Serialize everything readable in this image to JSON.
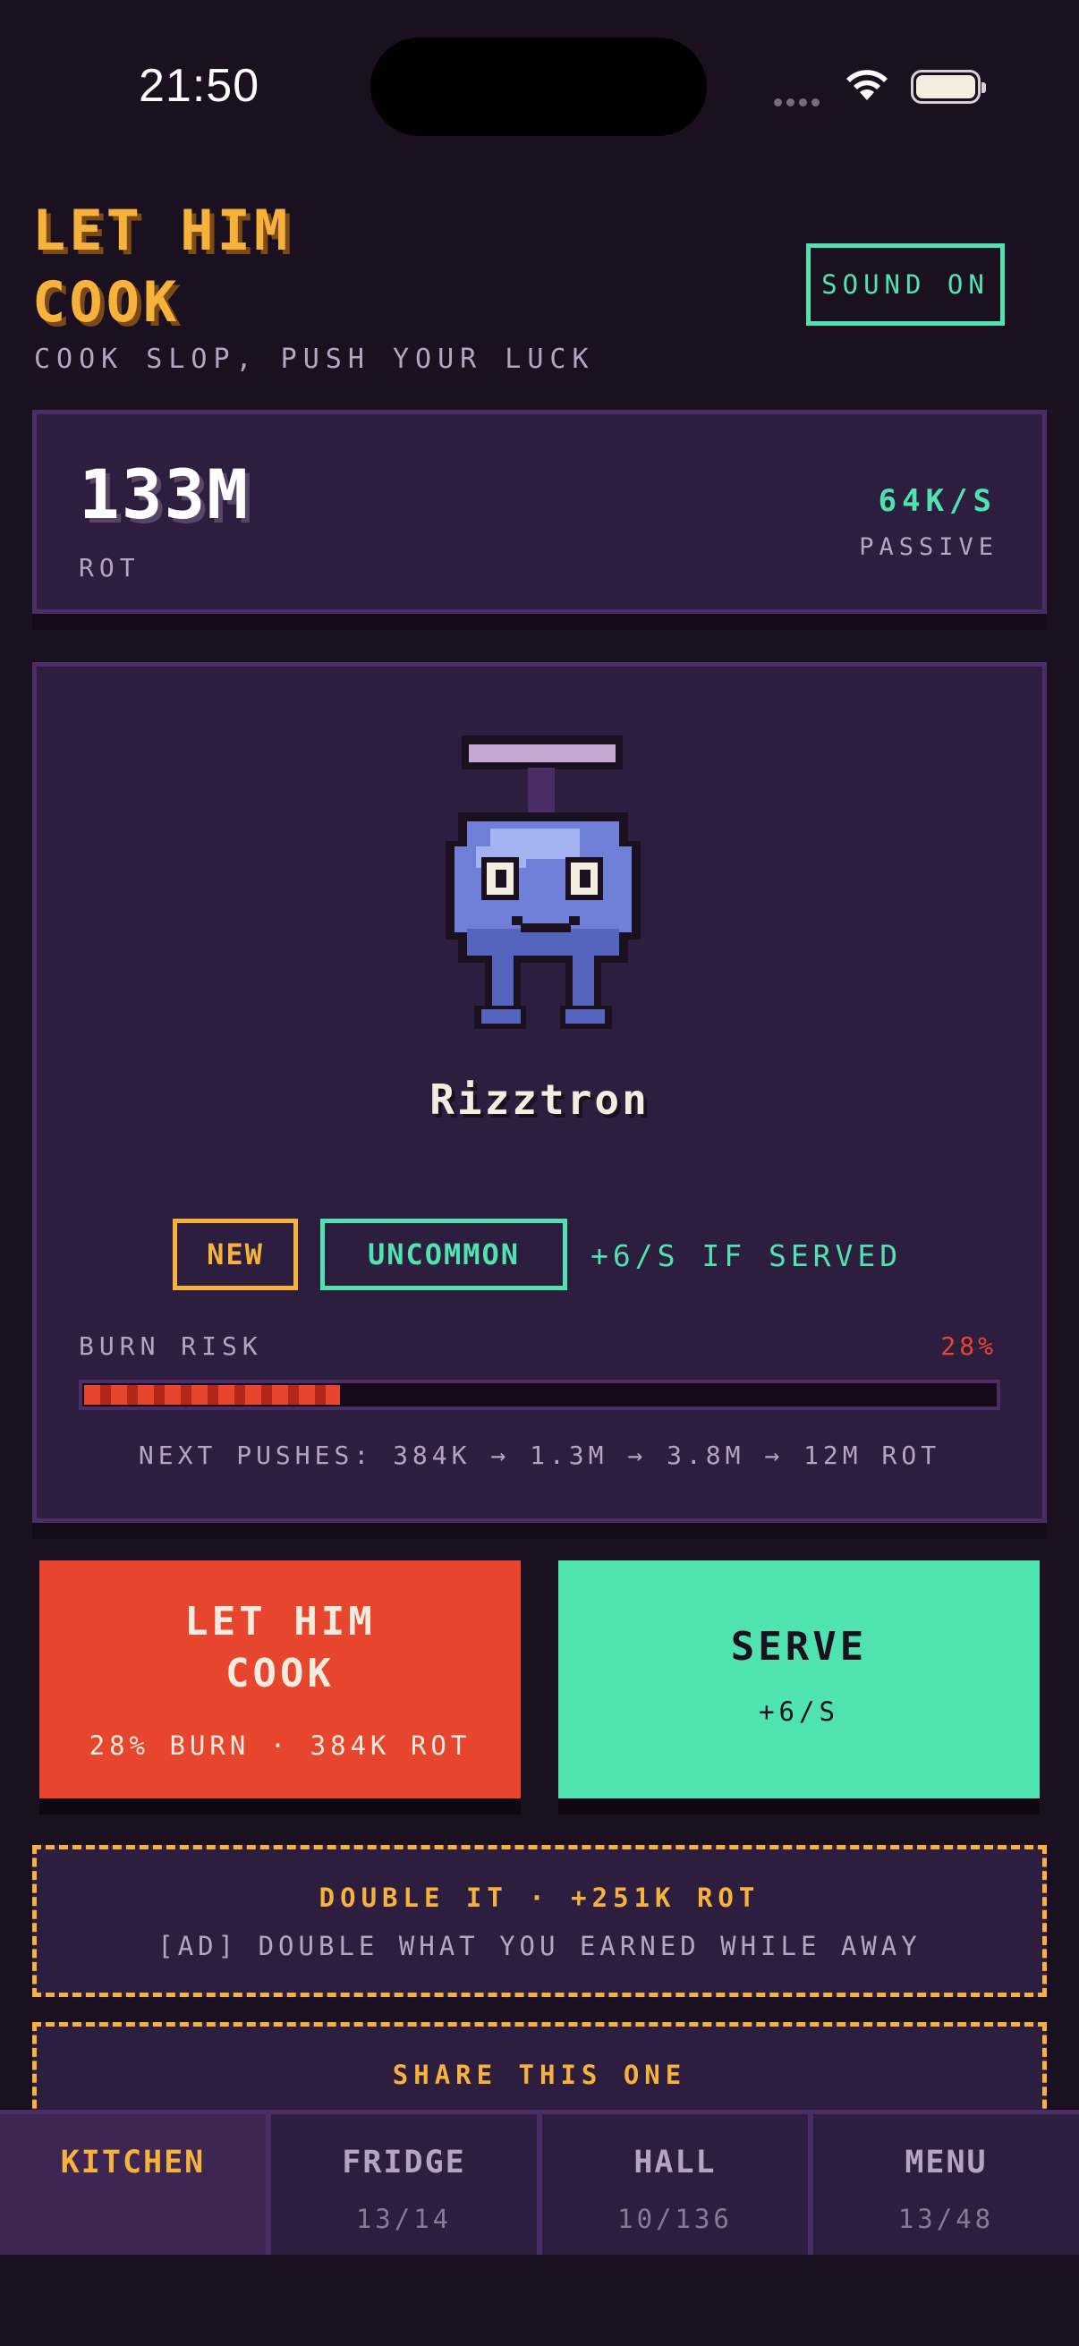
{
  "status": {
    "time": "21:50"
  },
  "header": {
    "title": "LET HIM COOK",
    "subtitle": "COOK SLOP, PUSH YOUR LUCK",
    "sound_label": "SOUND ON"
  },
  "stats": {
    "rot_value": "133M",
    "rot_label": "ROT",
    "rate_value": "64K/S",
    "rate_label": "PASSIVE"
  },
  "character": {
    "name": "Rizztron",
    "icon": "blue-robot-sprite",
    "badge_new": "NEW",
    "badge_rarity": "UNCOMMON",
    "served_text": "+6/S IF SERVED",
    "burn_label": "BURN RISK",
    "burn_pct_text": "28%",
    "burn_fraction": 0.28,
    "next_pushes": "NEXT PUSHES: 384K → 1.3M → 3.8M → 12M ROT"
  },
  "actions": {
    "cook_title": "LET HIM COOK",
    "cook_sub": "28% BURN · 384K ROT",
    "serve_title": "SERVE",
    "serve_sub": "+6/S"
  },
  "promo": {
    "double_title": "DOUBLE IT · +251K ROT",
    "double_sub": "[AD] DOUBLE WHAT YOU EARNED WHILE AWAY",
    "share_title": "SHARE THIS ONE"
  },
  "tabs": [
    {
      "label": "KITCHEN",
      "count": ""
    },
    {
      "label": "FRIDGE",
      "count": "13/14"
    },
    {
      "label": "HALL",
      "count": "10/136"
    },
    {
      "label": "MENU",
      "count": "13/48"
    }
  ],
  "colors": {
    "background": "#1b1020",
    "panel": "#2d1d3e",
    "accent_orange": "#f6b23b",
    "accent_green": "#4fe3b0",
    "accent_red": "#e8452e"
  }
}
